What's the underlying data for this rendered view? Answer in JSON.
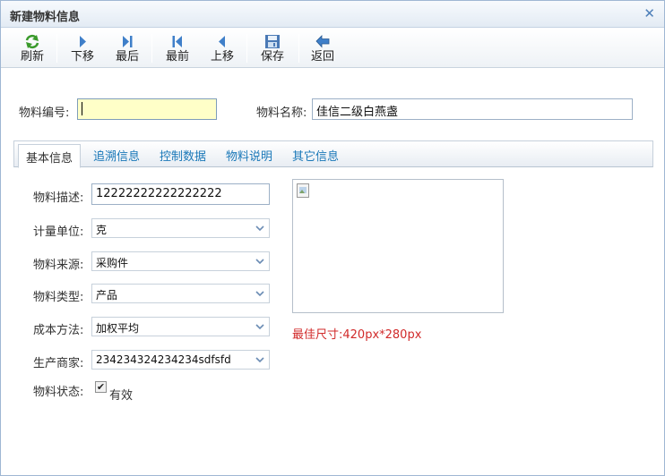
{
  "window": {
    "title": "新建物料信息"
  },
  "toolbar": {
    "refresh": "刷新",
    "next": "下移",
    "last": "最后",
    "first": "最前",
    "prev": "上移",
    "save": "保存",
    "back": "返回"
  },
  "header_form": {
    "code_label": "物料编号:",
    "code_value": "",
    "name_label": "物料名称:",
    "name_value": "佳信二级白燕盏"
  },
  "tabs": [
    "基本信息",
    "追溯信息",
    "控制数据",
    "物料说明",
    "其它信息"
  ],
  "basic": {
    "desc_label": "物料描述:",
    "desc_value": "12222222222222222",
    "unit_label": "计量单位:",
    "unit_value": "克",
    "source_label": "物料来源:",
    "source_value": "采购件",
    "type_label": "物料类型:",
    "type_value": "产品",
    "cost_label": "成本方法:",
    "cost_value": "加权平均",
    "maker_label": "生产商家:",
    "maker_value": "234234324234234sdfsfd",
    "status_label": "物料状态:",
    "status_checked": true,
    "status_text": "有效"
  },
  "image": {
    "hint": "最佳尺寸:420px*280px"
  },
  "colors": {
    "accent": "#1a78b8",
    "hint": "#d12a2a",
    "highlight_input": "#ffffc8"
  }
}
